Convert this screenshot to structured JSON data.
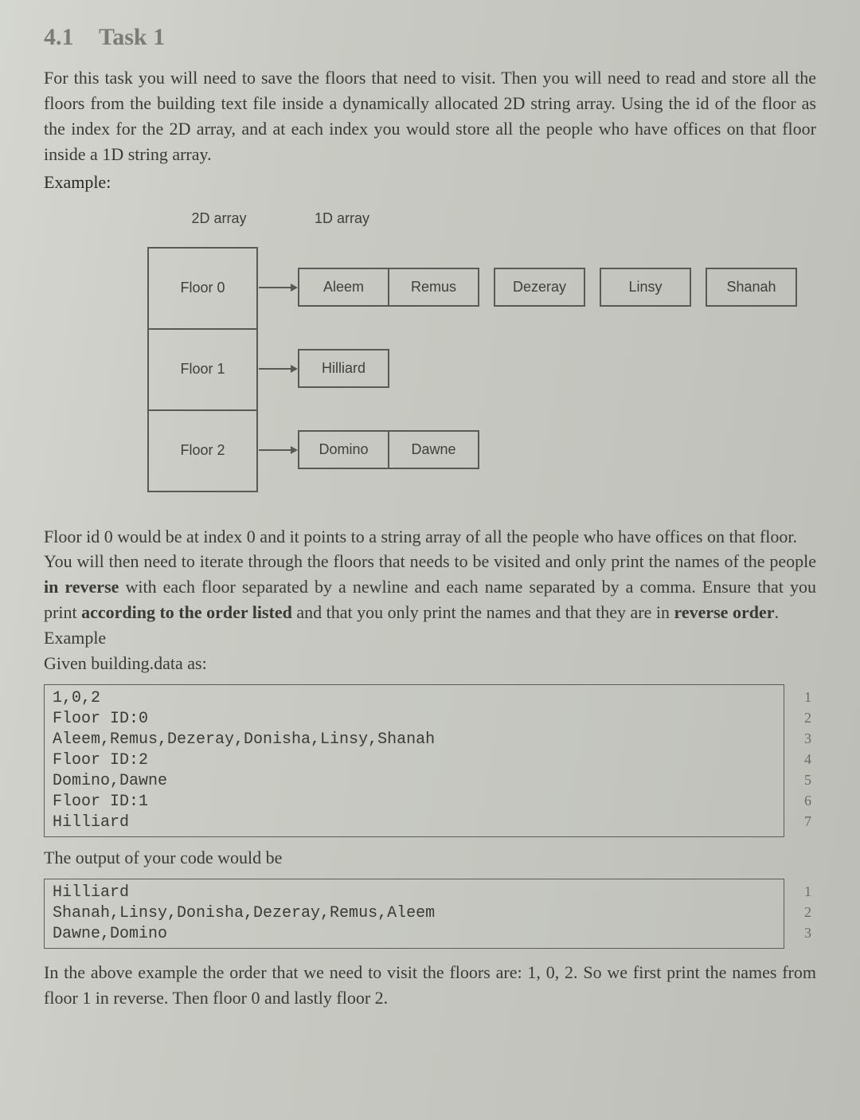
{
  "section": {
    "num": "4.1",
    "title": "Task 1"
  },
  "intro": "For this task you will need to save the floors that need to visit. Then you will need to read and store all the floors from the building text file inside a dynamically allocated 2D string array. Using the id of the floor as the index for the 2D array, and at each index you would store all the people who have offices on that floor inside a 1D string array.",
  "example_label": "Example:",
  "diagram": {
    "label2d": "2D array",
    "label1d": "1D array",
    "floors": [
      {
        "label": "Floor 0",
        "people": [
          "Aleem",
          "Remus",
          "Dezeray",
          "Linsy",
          "Shanah"
        ]
      },
      {
        "label": "Floor 1",
        "people": [
          "Hilliard"
        ]
      },
      {
        "label": "Floor 2",
        "people": [
          "Domino",
          "Dawne"
        ]
      }
    ]
  },
  "midpara1": "Floor id 0 would be at index 0 and it points to a string array of all the people who have offices on that floor.",
  "midpara2a": "You will then need to iterate through the floors that needs to be visited and only print the names of the people ",
  "midpara2b": "in reverse",
  "midpara2c": " with each floor separated by a newline and each name separated by a comma. Ensure that you print ",
  "midpara2d": "according to the order listed",
  "midpara2e": " and that you only print the names and that they are in ",
  "midpara2f": "reverse order",
  "midpara2g": ".",
  "example2": "Example",
  "given": "Given building.data as:",
  "code1": {
    "lines": [
      "1,0,2",
      "Floor ID:0",
      "Aleem,Remus,Dezeray,Donisha,Linsy,Shanah",
      "Floor ID:2",
      "Domino,Dawne",
      "Floor ID:1",
      "Hilliard"
    ],
    "nums": [
      "1",
      "2",
      "3",
      "4",
      "5",
      "6",
      "7"
    ]
  },
  "outputlabel": "The output of your code would be",
  "code2": {
    "lines": [
      "Hilliard",
      "Shanah,Linsy,Donisha,Dezeray,Remus,Aleem",
      "Dawne,Domino"
    ],
    "nums": [
      "1",
      "2",
      "3"
    ]
  },
  "closing": "In the above example the order that we need to visit the floors are: 1, 0, 2. So we first print the names from floor 1 in reverse. Then floor 0 and lastly floor 2."
}
